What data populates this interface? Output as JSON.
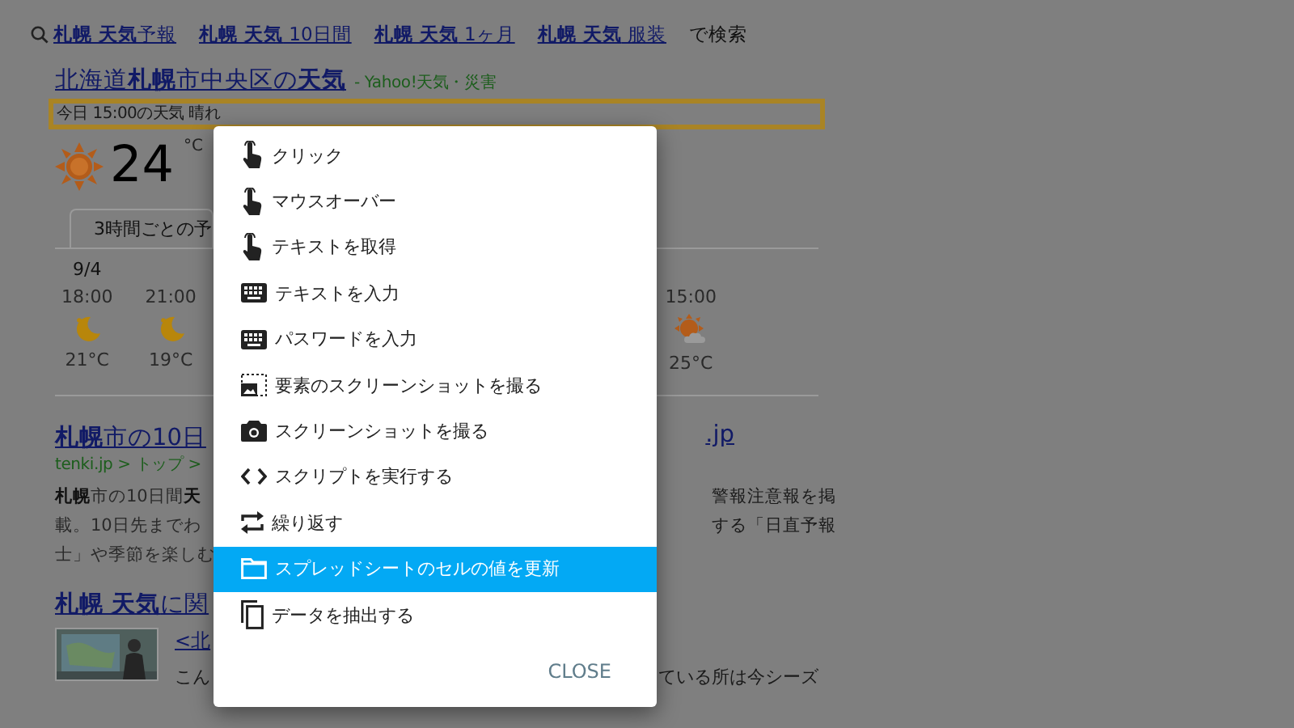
{
  "search_suggestions": {
    "links": [
      "**札幌 天気**予報",
      "**札幌 天気** 10日間",
      "**札幌 天気** 1ヶ月",
      "**札幌 天気** 服装"
    ],
    "suffix": "で検索"
  },
  "weather_result": {
    "title": "北海道**札幌**市中央区の**天気**",
    "source": "- Yahoo!天気・災害",
    "summary": "今日 15:00の天気 晴れ",
    "temp": "24",
    "unit": "°C",
    "tab": {
      "label": "3時間ごとの予",
      "selected": true
    },
    "forecast_left": [
      {
        "date": "9/4",
        "time": "18:00",
        "kind": "moon",
        "temp": "21°C"
      },
      {
        "time": "21:00",
        "kind": "moon",
        "temp": "19°C"
      }
    ],
    "forecast_right": [
      {
        "time": "15:00",
        "kind": "sun-cloud",
        "temp": "25°C"
      }
    ]
  },
  "result_2": {
    "title_left": "**札幌**市の10日",
    "title_right": ".jp",
    "breadcrumb": "tenki.jp > トップ >",
    "snippet_left": [
      "**札幌**市の10日間**天**",
      "載。10日先までわ",
      "士」や季節を楽しむ"
    ],
    "snippet_right": [
      "警報注意報を掲",
      "する「日直予報"
    ]
  },
  "result_3": {
    "title": "**札幌 天気**に関",
    "link": "<北",
    "text_left": "こん",
    "text_right": "ている所は今シーズ"
  },
  "action_menu": {
    "items": [
      {
        "kind": "pointer",
        "label": "クリック",
        "selected": false
      },
      {
        "kind": "pointer",
        "label": "マウスオーバー",
        "selected": false
      },
      {
        "kind": "pointer",
        "label": "テキストを取得",
        "selected": false
      },
      {
        "kind": "keyboard",
        "label": "テキストを入力",
        "selected": false
      },
      {
        "kind": "keyboard",
        "label": "パスワードを入力",
        "selected": false
      },
      {
        "kind": "element-screenshot",
        "label": "要素のスクリーンショットを撮る",
        "selected": false
      },
      {
        "kind": "camera",
        "label": "スクリーンショットを撮る",
        "selected": false
      },
      {
        "kind": "code",
        "label": "スクリプトを実行する",
        "selected": false
      },
      {
        "kind": "repeat",
        "label": "繰り返す",
        "selected": false
      },
      {
        "kind": "sheet",
        "label": "スプレッドシートのセルの値を更新",
        "selected": true
      },
      {
        "kind": "copy",
        "label": "データを抽出する",
        "selected": false
      }
    ],
    "close": "CLOSE"
  }
}
